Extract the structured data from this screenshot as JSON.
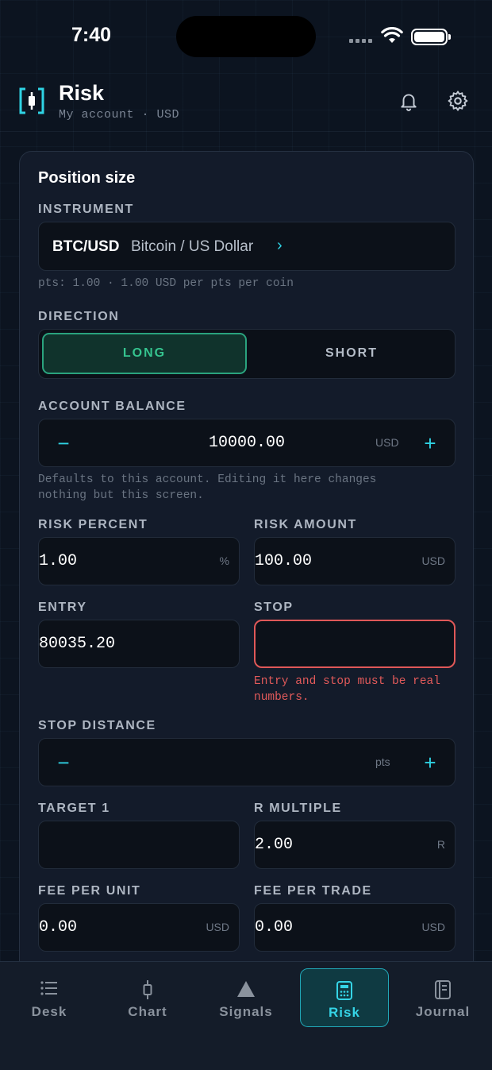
{
  "status": {
    "time": "7:40"
  },
  "header": {
    "title": "Risk",
    "subtitle": "My account · USD"
  },
  "card": {
    "title": "Position size",
    "instrument": {
      "label": "INSTRUMENT",
      "symbol": "BTC/USD",
      "name": "Bitcoin / US Dollar",
      "hint": "pts: 1.00 · 1.00 USD per pts per coin"
    },
    "direction": {
      "label": "DIRECTION",
      "long": "LONG",
      "short": "SHORT",
      "selected": "LONG"
    },
    "balance": {
      "label": "ACCOUNT BALANCE",
      "value": "10000.00",
      "unit": "USD",
      "hint_line1": "Defaults to this account. Editing it here changes",
      "hint_line2": "nothing but this screen."
    },
    "risk_percent": {
      "label": "RISK PERCENT",
      "value": "1.00",
      "unit": "%"
    },
    "risk_amount": {
      "label": "RISK AMOUNT",
      "value": "100.00",
      "unit": "USD"
    },
    "entry": {
      "label": "ENTRY",
      "value": "80035.20"
    },
    "stop": {
      "label": "STOP",
      "value": "",
      "error_line1": "Entry and stop must be real",
      "error_line2": "numbers."
    },
    "stop_distance": {
      "label": "STOP DISTANCE",
      "value": "",
      "unit": "pts"
    },
    "target1": {
      "label": "TARGET 1",
      "value": ""
    },
    "r_multiple": {
      "label": "R MULTIPLE",
      "value": "2.00",
      "unit": "R"
    },
    "fee_unit": {
      "label": "FEE PER UNIT",
      "value": "0.00",
      "unit": "USD"
    },
    "fee_trade": {
      "label": "FEE PER TRADE",
      "value": "0.00",
      "unit": "USD"
    }
  },
  "nav": {
    "items": [
      {
        "label": "Desk",
        "icon": "list-icon"
      },
      {
        "label": "Chart",
        "icon": "candlestick-icon"
      },
      {
        "label": "Signals",
        "icon": "triangle-icon"
      },
      {
        "label": "Risk",
        "icon": "calculator-icon",
        "active": true
      },
      {
        "label": "Journal",
        "icon": "journal-icon"
      }
    ]
  },
  "colors": {
    "accent": "#2fd3e4",
    "long": "#35c48f",
    "error": "#e25a5a"
  }
}
